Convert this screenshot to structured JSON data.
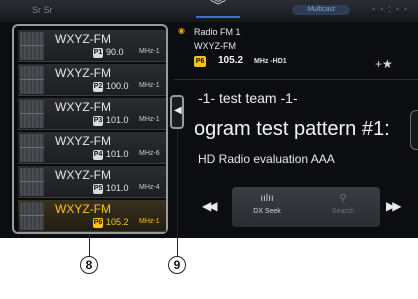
{
  "topbar": {
    "left_text": "Sr  Sr",
    "center_icon": "chevron-double-down-icon",
    "badge": "Multicast",
    "clock": "- - : - -"
  },
  "presets": [
    {
      "station": "WXYZ-FM",
      "preset": "P1",
      "freq": "90.0",
      "unit": "MHz-1",
      "active": false
    },
    {
      "station": "WXYZ-FM",
      "preset": "P2",
      "freq": "100.0",
      "unit": "MHz-1",
      "active": false
    },
    {
      "station": "WXYZ-FM",
      "preset": "P3",
      "freq": "101.0",
      "unit": "MHz-1",
      "active": false
    },
    {
      "station": "WXYZ-FM",
      "preset": "P4",
      "freq": "101.0",
      "unit": "MHz-6",
      "active": false
    },
    {
      "station": "WXYZ-FM",
      "preset": "P5",
      "freq": "101.0",
      "unit": "MHz-4",
      "active": false
    },
    {
      "station": "WXYZ-FM",
      "preset": "P6",
      "freq": "105.2",
      "unit": "MHz-1",
      "active": true
    }
  ],
  "now_playing": {
    "source": "Radio FM 1",
    "station": "WXYZ-FM",
    "preset": "P6",
    "freq": "105.2",
    "unit": "MHz -HD1",
    "fav_icon": "+★",
    "artist": "-1- test team -1-",
    "title": "ogram test pattern #1:",
    "album": "HD Radio evaluation AAA"
  },
  "controls": {
    "dx_seek": "DX Seek",
    "search": "Search"
  },
  "callouts": {
    "c8": "8",
    "c9": "9"
  },
  "colors": {
    "accent": "#ffc21a",
    "background": "#0b0d10"
  }
}
